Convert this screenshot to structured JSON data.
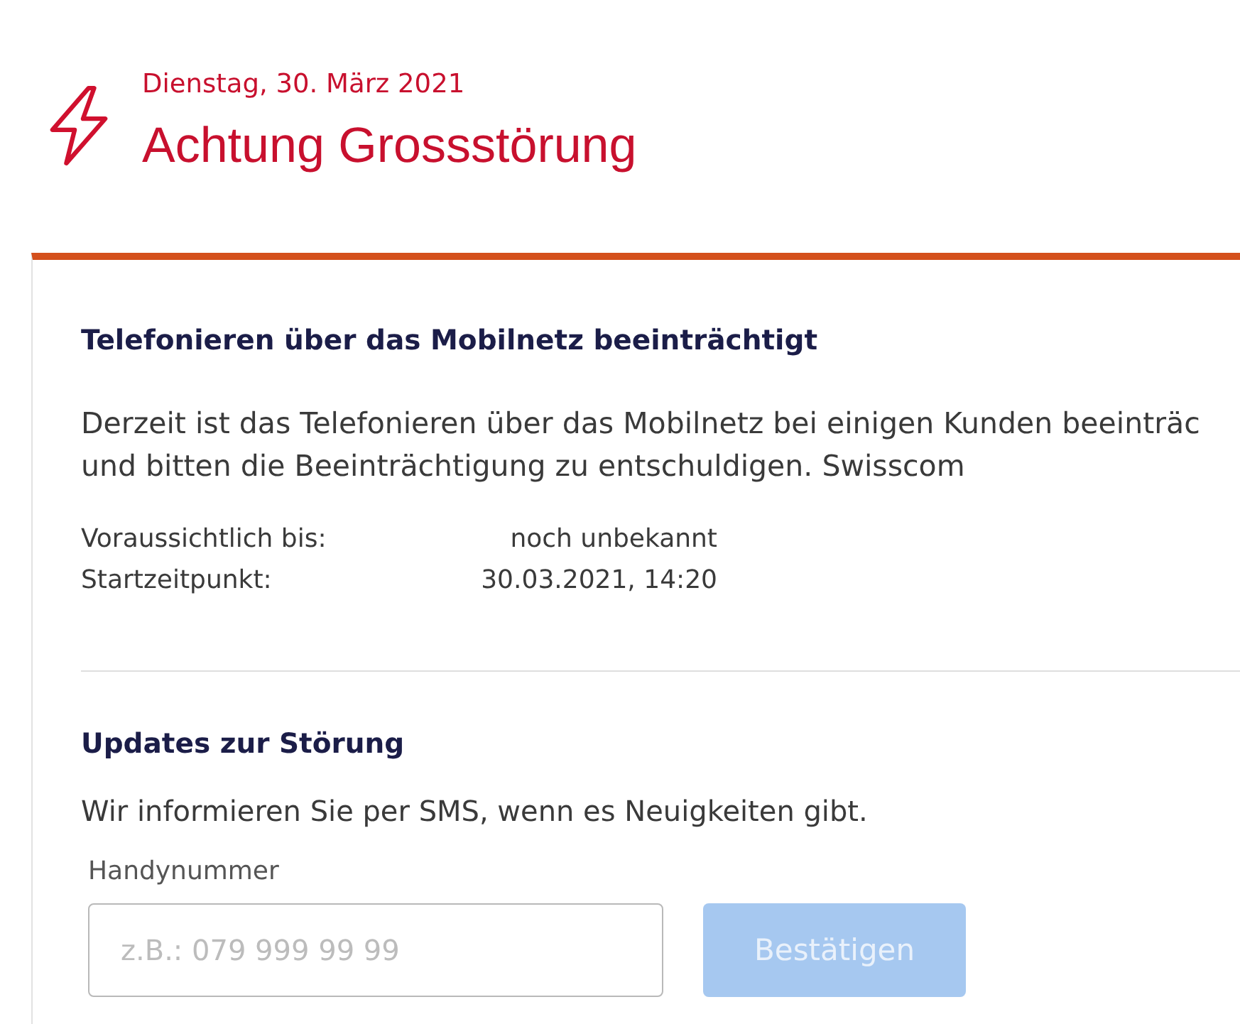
{
  "header": {
    "date": "Dienstag, 30. März 2021",
    "title": "Achtung Grossstörung"
  },
  "notice": {
    "heading": "Telefonieren über das Mobilnetz beeinträchtigt",
    "text": "Derzeit ist das Telefonieren über das Mobilnetz bei einigen Kunden beeinträc\nund bitten die Beeinträchtigung zu entschuldigen. Swisscom",
    "details": [
      {
        "label": "Voraussichtlich bis:",
        "value": "noch unbekannt"
      },
      {
        "label": "Startzeitpunkt:",
        "value": "30.03.2021, 14:20"
      }
    ]
  },
  "updates": {
    "heading": "Updates zur Störung",
    "text": "Wir informieren Sie per SMS, wenn es Neuigkeiten gibt.",
    "field": {
      "label": "Handynummer",
      "placeholder": "z.B.: 079 999 99 99"
    },
    "button": {
      "label": "Bestätigen",
      "disabled": true
    }
  }
}
